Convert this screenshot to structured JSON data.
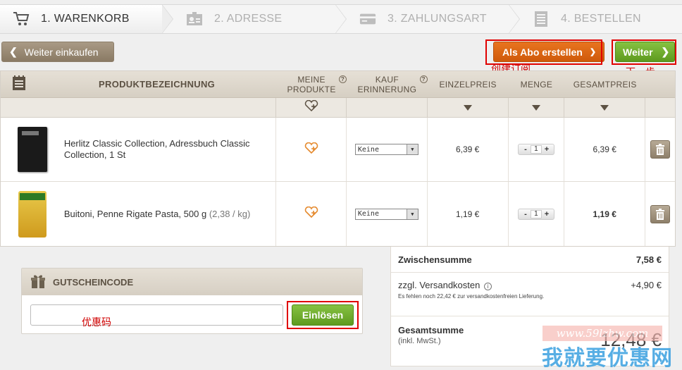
{
  "steps": [
    {
      "label": "1. WARENKORB",
      "icon": "cart-icon",
      "active": true
    },
    {
      "label": "2. ADRESSE",
      "icon": "address-card-icon",
      "active": false
    },
    {
      "label": "3. ZAHLUNGSART",
      "icon": "credit-card-icon",
      "active": false
    },
    {
      "label": "4. BESTELLEN",
      "icon": "order-list-icon",
      "active": false
    }
  ],
  "toolbar": {
    "continue_shopping": "Weiter einkaufen",
    "abo_button": "Als Abo erstellen",
    "next_button": "Weiter"
  },
  "annotations": {
    "abo": "创建订阅",
    "next": "下一步",
    "voucher": "优惠码"
  },
  "table": {
    "headers": {
      "product": "PRODUKTBEZEICHNUNG",
      "my_products_line1": "MEINE",
      "my_products_line2": "PRODUKTE",
      "reminder_line1": "KAUF",
      "reminder_line2": "ERINNERUNG",
      "unit_price": "EINZELPREIS",
      "quantity": "MENGE",
      "total_price": "GESAMTPREIS"
    },
    "rows": [
      {
        "name": "Herlitz Classic Collection, Adressbuch Classic Collection, 1 St",
        "unit_info": "",
        "reminder": "Keine",
        "unit_price": "6,39 €",
        "quantity": "1",
        "total_price": "6,39 €"
      },
      {
        "name": "Buitoni, Penne Rigate Pasta, 500 g",
        "unit_info": "(2,38 / kg)",
        "reminder": "Keine",
        "unit_price": "1,19 €",
        "quantity": "1",
        "total_price": "1,19 €"
      }
    ]
  },
  "summary": {
    "subtotal_label": "Zwischensumme",
    "subtotal_value": "7,58 €",
    "shipping_label": "zzgl. Versandkosten",
    "shipping_value": "+4,90 €",
    "shipping_note": "Es fehlen noch 22,42 € zur versandkostenfreien Lieferung.",
    "total_label": "Gesamtsumme",
    "total_sub": "(inkl. MwSt.)",
    "total_value": "12,48 €"
  },
  "voucher": {
    "title": "GUTSCHEINCODE",
    "input_value": "",
    "redeem_button": "Einlösen"
  },
  "watermark": {
    "url": "www.59lzhw.com",
    "text": "我就要优惠网"
  },
  "colors": {
    "accent_green": "#6aa82a",
    "accent_orange": "#dd6614",
    "brown_header": "#d6cfc3",
    "annotation_red": "#e00000"
  }
}
